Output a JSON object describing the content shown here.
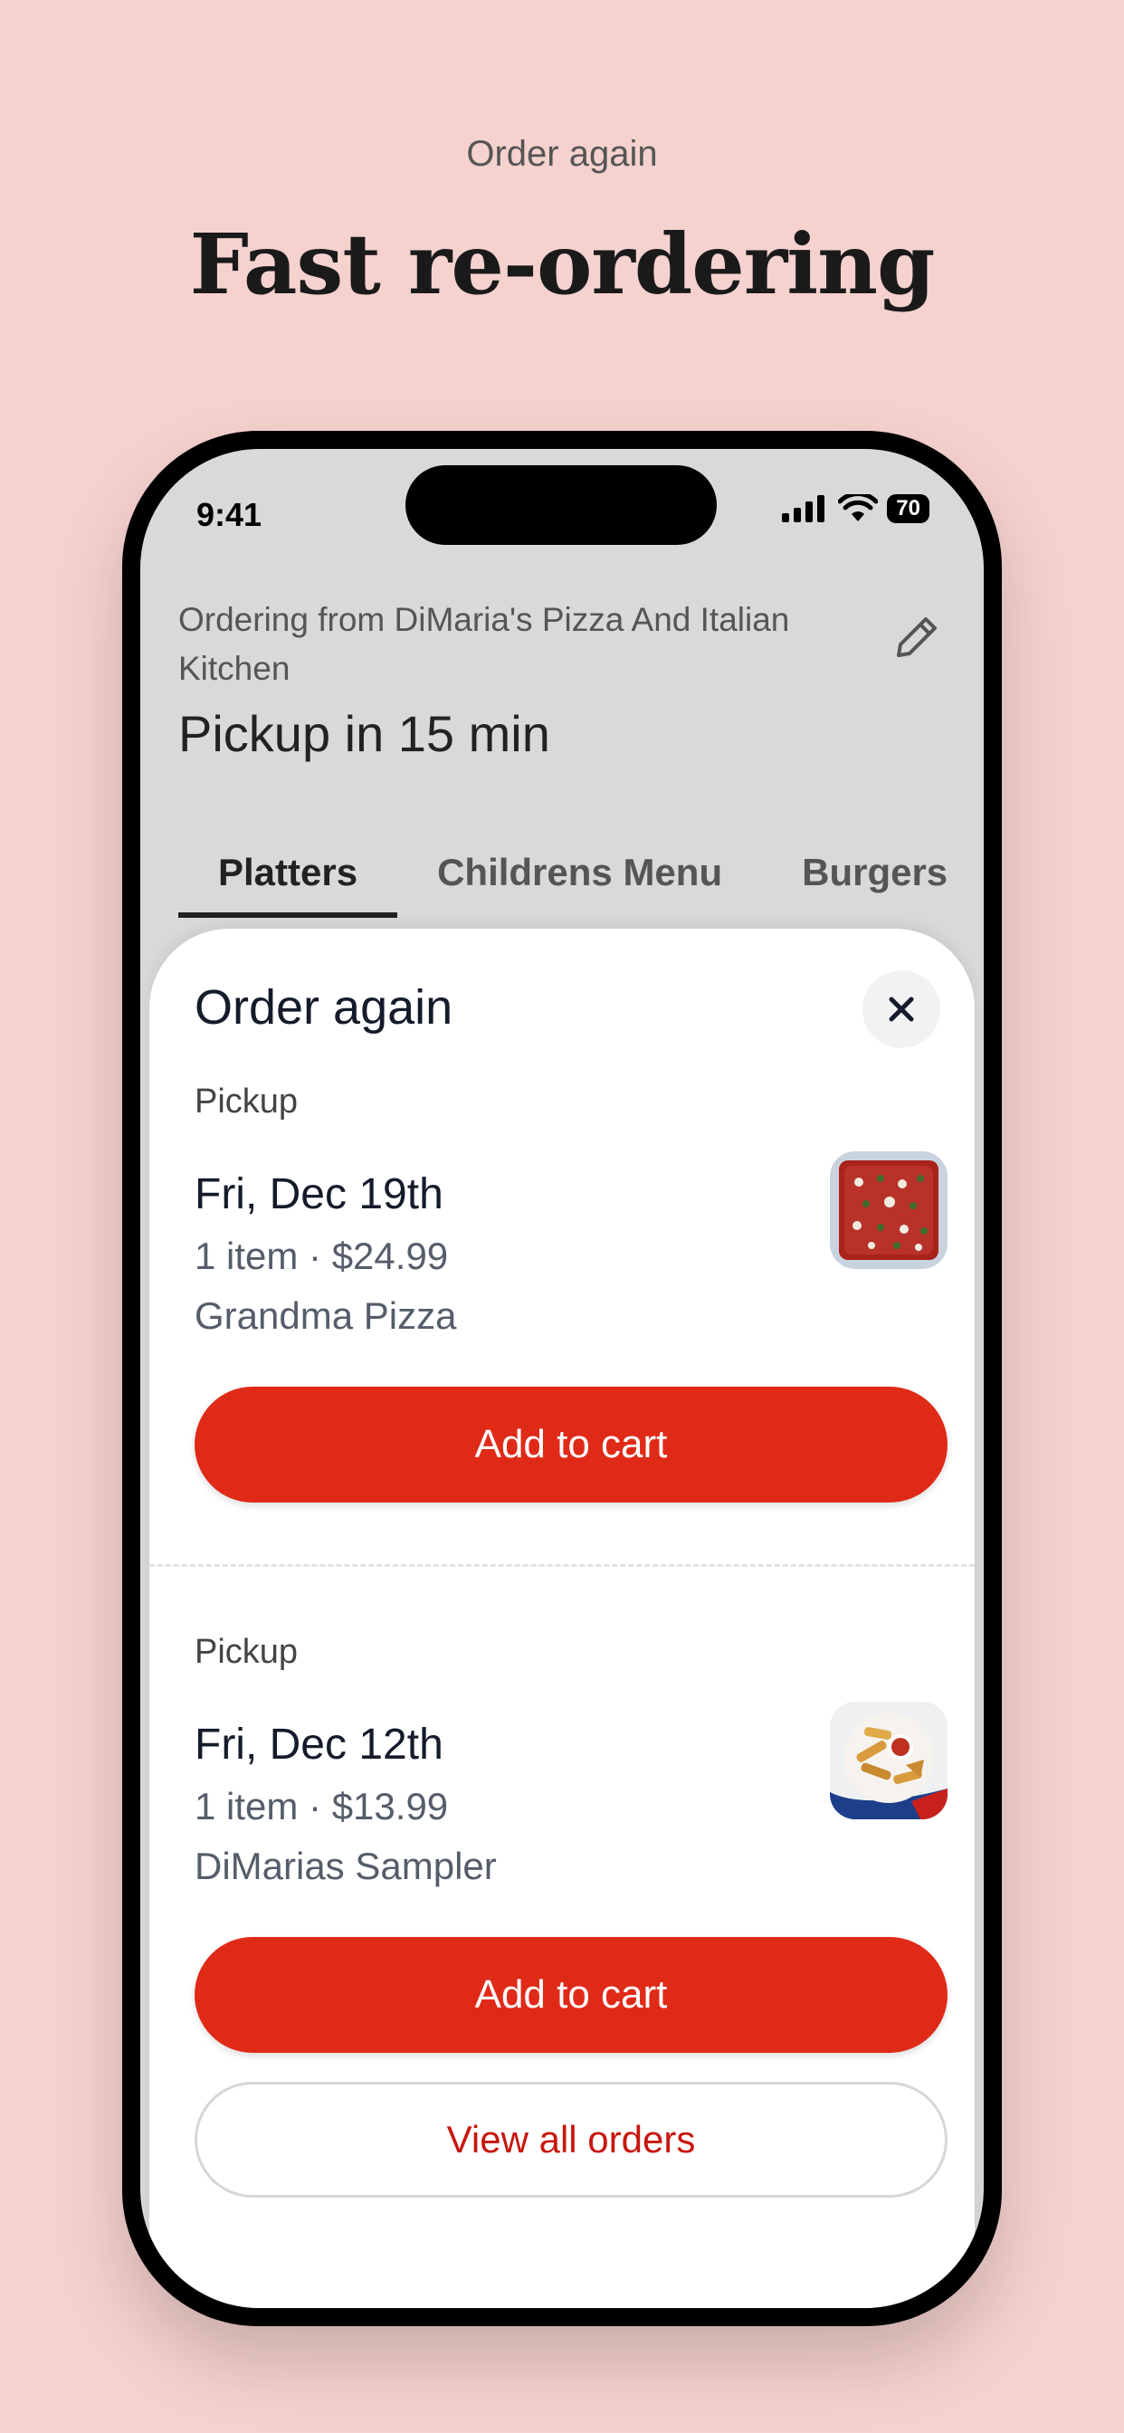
{
  "promo": {
    "eyebrow": "Order again",
    "headline": "Fast re-ordering"
  },
  "status_bar": {
    "time": "9:41",
    "battery": "70",
    "icons": [
      "signal-icon",
      "wifi-icon",
      "battery-icon"
    ]
  },
  "header": {
    "ordering_from": "Ordering from DiMaria's Pizza And Italian Kitchen",
    "pickup": "Pickup in 15 min",
    "edit_icon": "pencil-icon"
  },
  "tabs": [
    {
      "label": "Platters",
      "active": true
    },
    {
      "label": "Childrens Menu",
      "active": false
    },
    {
      "label": "Burgers",
      "active": false
    }
  ],
  "sheet": {
    "title": "Order again",
    "close_icon": "close-icon",
    "orders": [
      {
        "type": "Pickup",
        "date": "Fri, Dec 19th",
        "summary": "1 item · $24.99",
        "item": "Grandma Pizza",
        "button": "Add to cart"
      },
      {
        "type": "Pickup",
        "date": "Fri, Dec 12th",
        "summary": "1 item · $13.99",
        "item": "DiMarias Sampler",
        "button": "Add to cart"
      }
    ],
    "view_all": "View all orders"
  },
  "colors": {
    "background": "#f6d2cf",
    "primary": "#e02a18",
    "link": "#c8170e"
  }
}
